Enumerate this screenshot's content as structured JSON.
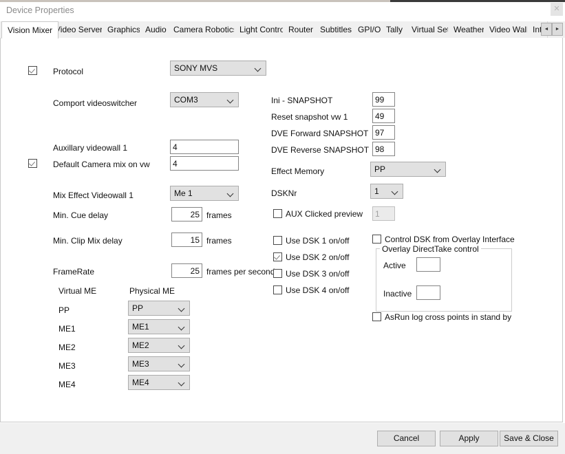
{
  "window": {
    "title": "Device Properties",
    "close_icon": "close-icon",
    "close_glyph": "✕"
  },
  "tabs": {
    "items": [
      {
        "label": "Vision Mixer",
        "active": true
      },
      {
        "label": "Video Servers",
        "active": false
      },
      {
        "label": "Graphics",
        "active": false
      },
      {
        "label": "Audio",
        "active": false
      },
      {
        "label": "Camera Robotics",
        "active": false
      },
      {
        "label": "Light Control",
        "active": false
      },
      {
        "label": "Router",
        "active": false
      },
      {
        "label": "Subtitles",
        "active": false
      },
      {
        "label": "GPI/O",
        "active": false
      },
      {
        "label": "Tally",
        "active": false
      },
      {
        "label": "Virtual Set",
        "active": false
      },
      {
        "label": "Weather",
        "active": false
      },
      {
        "label": "Video Wall",
        "active": false
      },
      {
        "label": "Int",
        "active": false
      }
    ],
    "scroll_left_glyph": "◄",
    "scroll_right_glyph": "►"
  },
  "left_column": {
    "protocol": {
      "label": "Protocol",
      "checked": true,
      "value": "SONY MVS"
    },
    "comport": {
      "label": "Comport videoswitcher",
      "value": "COM3"
    },
    "auxillary_videowall": {
      "label": "Auxillary videowall 1",
      "value": "4"
    },
    "default_camera_mix": {
      "label": "Default Camera mix on vw",
      "checked": true,
      "value": "4"
    },
    "mix_effect_videowall": {
      "label": "Mix Effect Videowall 1",
      "value": "Me 1"
    },
    "min_cue_delay": {
      "label": "Min. Cue delay",
      "value": "25",
      "unit": "frames"
    },
    "min_clip_mix_delay": {
      "label": "Min. Clip Mix delay",
      "value": "15",
      "unit": "frames"
    },
    "framerate": {
      "label": "FrameRate",
      "value": "25",
      "unit": "frames per second"
    },
    "me_table": {
      "header_virtual": "Virtual ME",
      "header_physical": "Physical ME",
      "rows": [
        {
          "virtual": "PP",
          "physical": "PP"
        },
        {
          "virtual": "ME1",
          "physical": "ME1"
        },
        {
          "virtual": "ME2",
          "physical": "ME2"
        },
        {
          "virtual": "ME3",
          "physical": "ME3"
        },
        {
          "virtual": "ME4",
          "physical": "ME4"
        }
      ]
    }
  },
  "right_column": {
    "snapshots": [
      {
        "label": "Ini - SNAPSHOT",
        "value": "99"
      },
      {
        "label": "Reset snapshot vw 1",
        "value": "49"
      },
      {
        "label": "DVE Forward SNAPSHOT",
        "value": "97"
      },
      {
        "label": "DVE Reverse SNAPSHOT",
        "value": "98"
      }
    ],
    "effect_memory": {
      "label": "Effect Memory",
      "value": "PP"
    },
    "dsknr": {
      "label": "DSKNr",
      "value": "1"
    },
    "aux_clicked_preview": {
      "label": "AUX Clicked preview",
      "checked": false,
      "value": "1",
      "disabled": true
    },
    "dsk_toggles": [
      {
        "label": "Use DSK 1 on/off",
        "checked": false
      },
      {
        "label": "Use DSK 2 on/off",
        "checked": true
      },
      {
        "label": "Use DSK 3 on/off",
        "checked": false
      },
      {
        "label": "Use DSK 4 on/off",
        "checked": false
      }
    ],
    "control_dsk_overlay": {
      "label": "Control DSK from Overlay Interface",
      "checked": false
    },
    "overlay_group": {
      "title": "Overlay DirectTake control",
      "active_label": "Active",
      "active_value": "",
      "inactive_label": "Inactive",
      "inactive_value": ""
    },
    "asrun_log": {
      "label": "AsRun log cross points in stand by",
      "checked": false
    }
  },
  "footer": {
    "cancel_label": "Cancel",
    "apply_label": "Apply",
    "save_close_label": "Save & Close"
  }
}
